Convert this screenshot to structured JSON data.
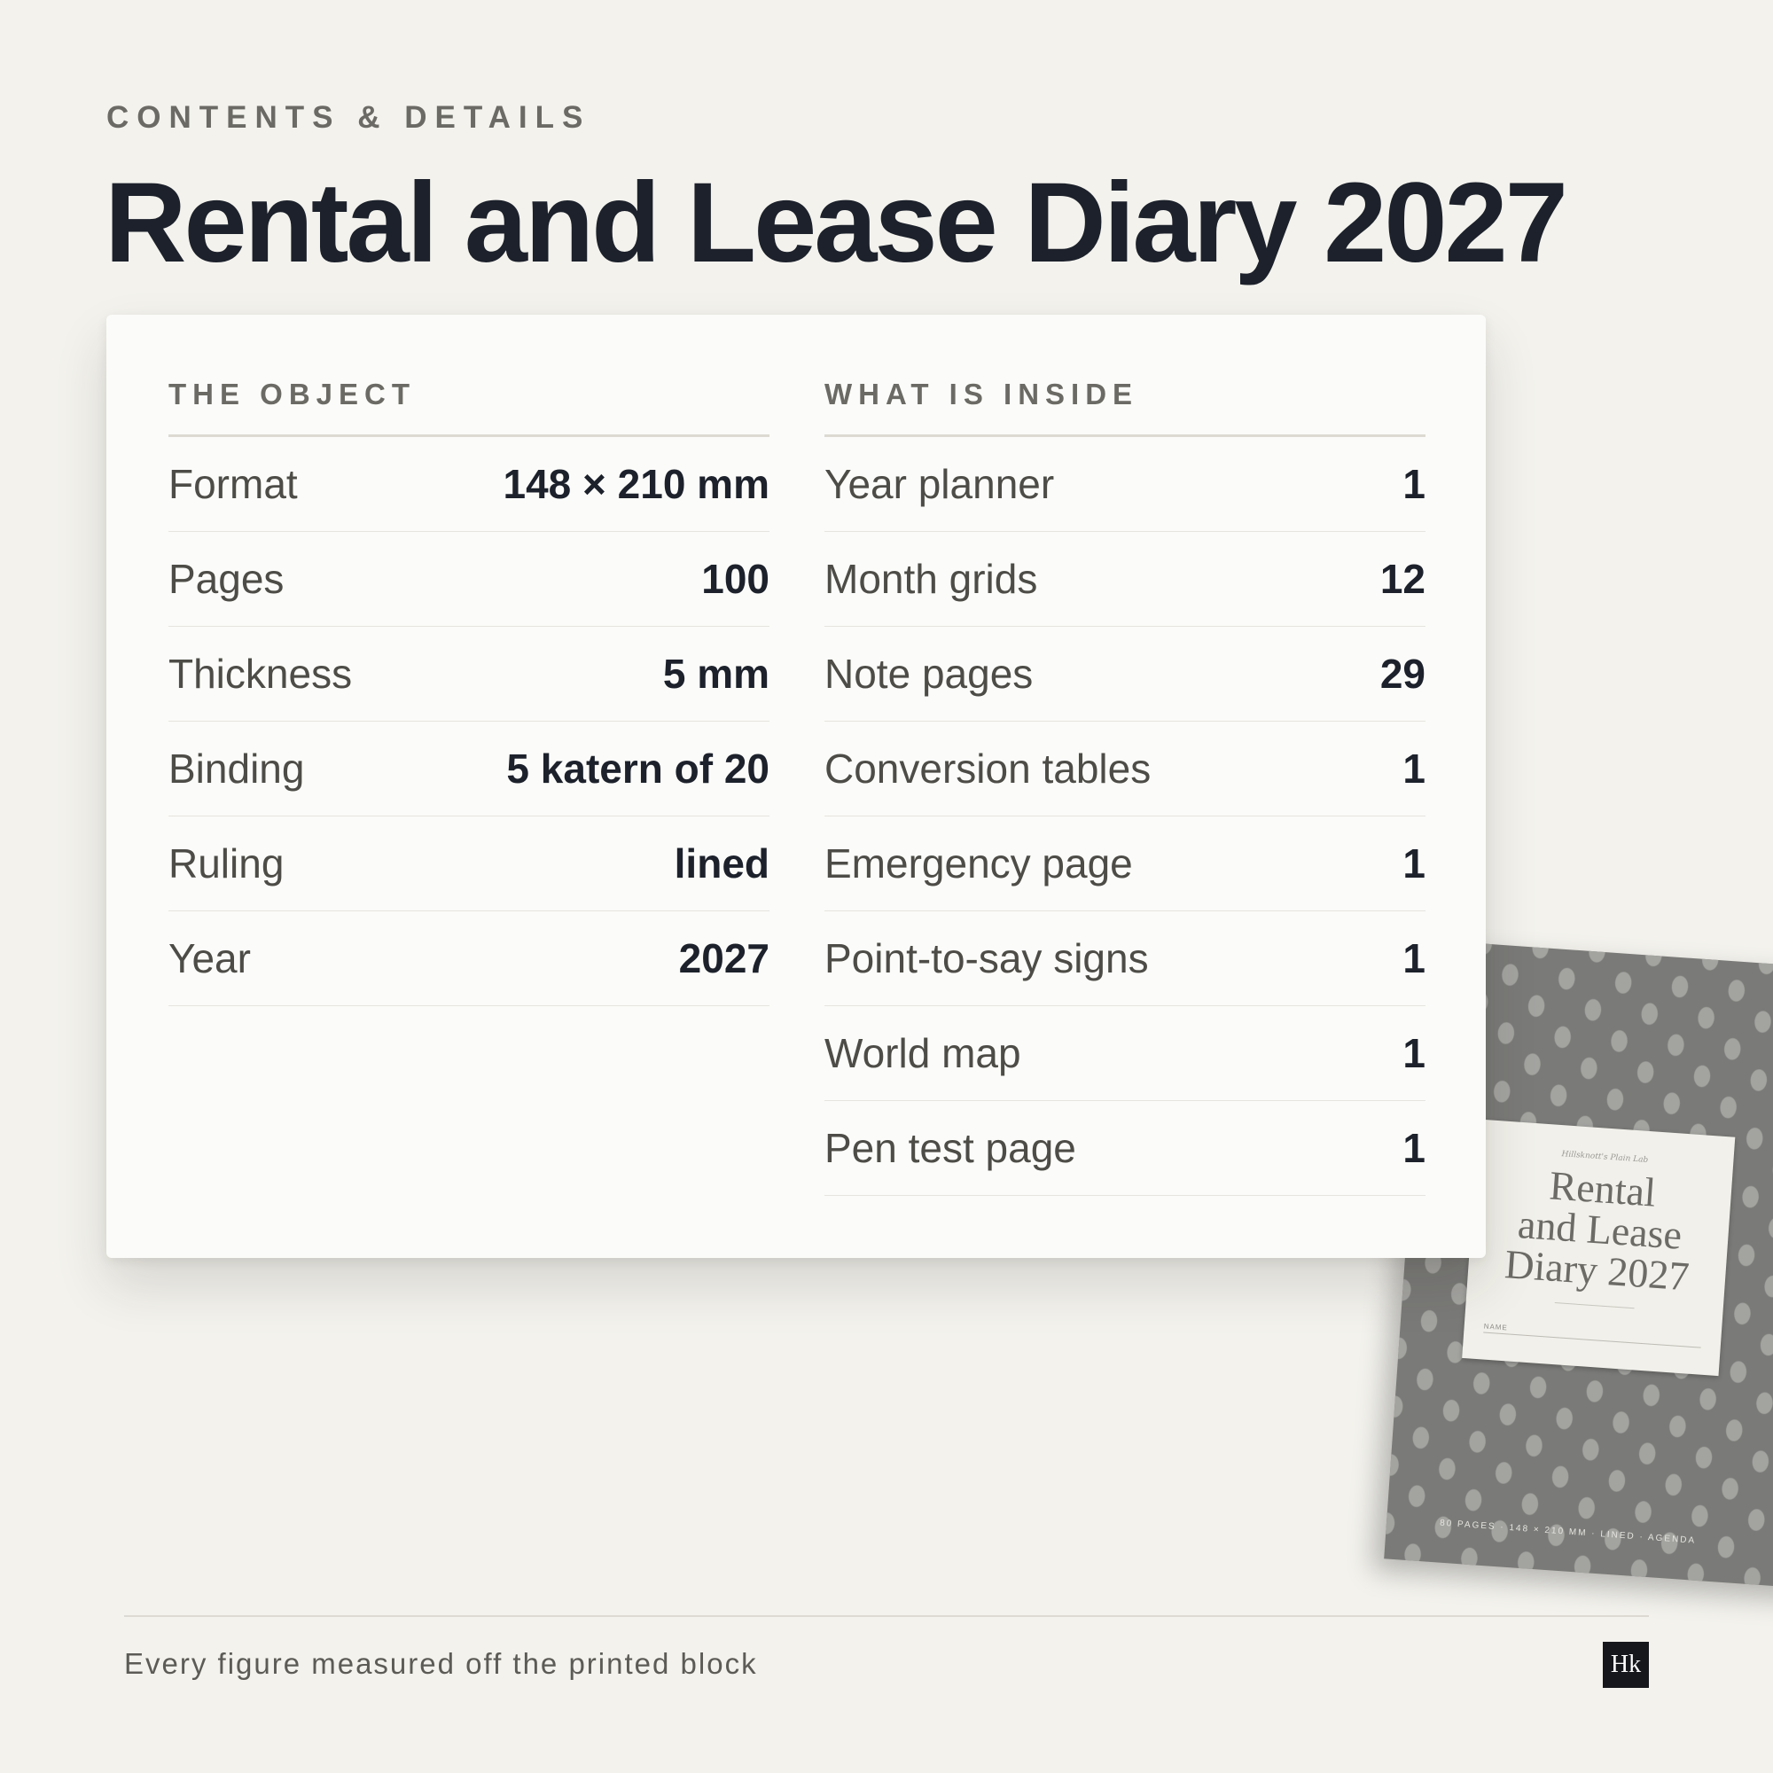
{
  "header": {
    "eyebrow": "CONTENTS & DETAILS",
    "title": "Rental and Lease Diary 2027"
  },
  "card": {
    "object": {
      "heading": "THE OBJECT",
      "rows": [
        {
          "label": "Format",
          "value": "148 × 210 mm"
        },
        {
          "label": "Pages",
          "value": "100"
        },
        {
          "label": "Thickness",
          "value": "5 mm"
        },
        {
          "label": "Binding",
          "value": "5 katern of 20"
        },
        {
          "label": "Ruling",
          "value": "lined"
        },
        {
          "label": "Year",
          "value": "2027"
        }
      ]
    },
    "inside": {
      "heading": "WHAT IS INSIDE",
      "rows": [
        {
          "label": "Year planner",
          "value": "1"
        },
        {
          "label": "Month grids",
          "value": "12"
        },
        {
          "label": "Note pages",
          "value": "29"
        },
        {
          "label": "Conversion tables",
          "value": "1"
        },
        {
          "label": "Emergency page",
          "value": "1"
        },
        {
          "label": "Point-to-say signs",
          "value": "1"
        },
        {
          "label": "World map",
          "value": "1"
        },
        {
          "label": "Pen test page",
          "value": "1"
        }
      ]
    }
  },
  "product": {
    "brand": "Hillsknott's Plain Lab",
    "title_lines": [
      "Rental",
      "and Lease",
      "Diary 2027"
    ],
    "name_label": "NAME",
    "footer": "80 PAGES · 148 × 210 MM · LINED · AGENDA"
  },
  "footer": {
    "note": "Every figure measured off the printed block",
    "logo": "Hk"
  }
}
